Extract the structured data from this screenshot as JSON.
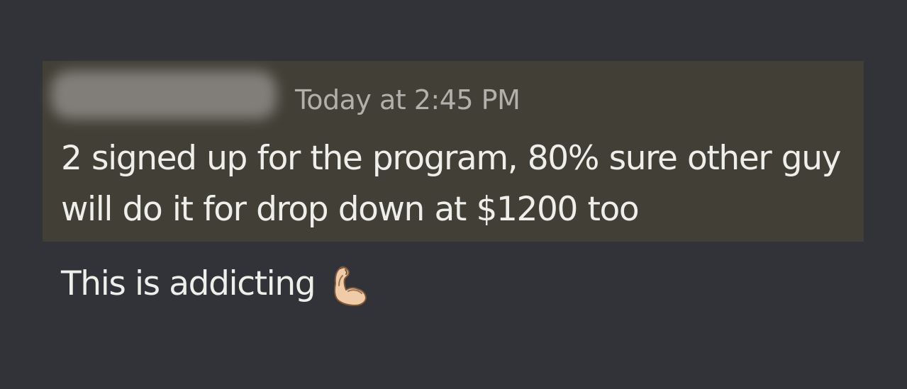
{
  "message": {
    "author": "",
    "timestamp": "Today at 2:45 PM",
    "text": "2 signed up for the program, 80% sure other guy will do it for drop down at $1200 too",
    "highlighted": true,
    "highlight_color": "#423f36"
  },
  "followup": {
    "text": "This is addicting",
    "emoji_icon": "flexed-biceps-icon"
  },
  "colors": {
    "background": "#313338",
    "text": "#eeeeea",
    "timestamp": "#b1b0aa"
  }
}
